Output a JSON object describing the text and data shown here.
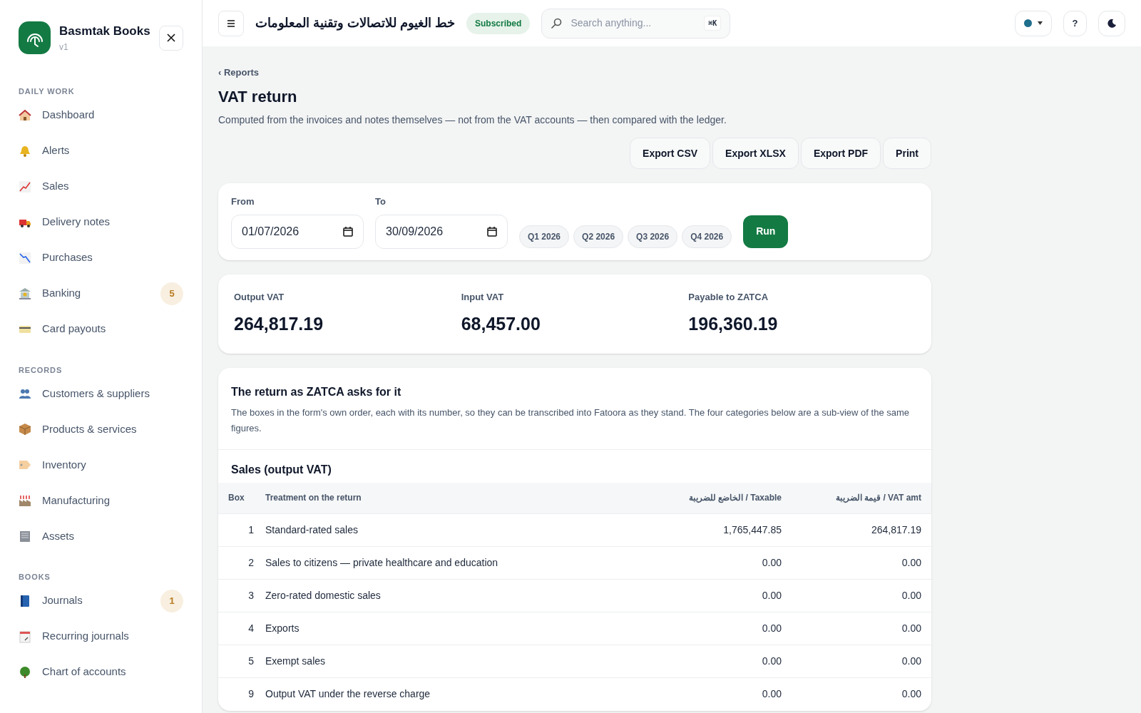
{
  "brand": {
    "name": "Basmtak Books",
    "version": "v1"
  },
  "sidebar": {
    "sections": [
      {
        "title": "DAILY WORK",
        "items": [
          {
            "label": "Dashboard"
          },
          {
            "label": "Alerts"
          },
          {
            "label": "Sales"
          },
          {
            "label": "Delivery notes"
          },
          {
            "label": "Purchases"
          },
          {
            "label": "Banking",
            "badge": "5"
          },
          {
            "label": "Card payouts"
          }
        ]
      },
      {
        "title": "RECORDS",
        "items": [
          {
            "label": "Customers & suppliers"
          },
          {
            "label": "Products & services"
          },
          {
            "label": "Inventory"
          },
          {
            "label": "Manufacturing"
          },
          {
            "label": "Assets"
          }
        ]
      },
      {
        "title": "BOOKS",
        "items": [
          {
            "label": "Journals",
            "badge": "1"
          },
          {
            "label": "Recurring journals"
          },
          {
            "label": "Chart of accounts"
          }
        ]
      }
    ]
  },
  "header": {
    "company": "خط الغيوم للاتصالات وتقنية المعلومات",
    "status": "Subscribed",
    "search": {
      "placeholder": "Search anything...",
      "shortcut": "⌘K"
    },
    "help": "?"
  },
  "breadcrumb": "‹ Reports",
  "title": "VAT return",
  "subtitle": "Computed from the invoices and notes themselves — not from the VAT accounts — then compared with the ledger.",
  "actions": [
    "Export CSV",
    "Export XLSX",
    "Export PDF",
    "Print"
  ],
  "filters": {
    "from": {
      "label": "From",
      "value": "01/07/2026"
    },
    "to": {
      "label": "To",
      "value": "30/09/2026"
    },
    "quarters": [
      "Q1 2026",
      "Q2 2026",
      "Q3 2026",
      "Q4 2026"
    ],
    "run": "Run"
  },
  "summary": [
    {
      "label": "Output VAT",
      "value": "264,817.19"
    },
    {
      "label": "Input VAT",
      "value": "68,457.00"
    },
    {
      "label": "Payable to ZATCA",
      "value": "196,360.19"
    }
  ],
  "return": {
    "title": "The return as ZATCA asks for it",
    "description": "The boxes in the form's own order, each with its number, so they can be transcribed into Fatoora as they stand. The four categories below are a sub-view of the same figures.",
    "section_title": "Sales (output VAT)",
    "columns": [
      "Box",
      "Treatment on the return",
      "الخاضع للضريبة / Taxable",
      "قيمة الضريبة / VAT amt"
    ],
    "rows": [
      [
        "1",
        "Standard-rated sales",
        "1,765,447.85",
        "264,817.19"
      ],
      [
        "2",
        "Sales to citizens — private healthcare and education",
        "0.00",
        "0.00"
      ],
      [
        "3",
        "Zero-rated domestic sales",
        "0.00",
        "0.00"
      ],
      [
        "4",
        "Exports",
        "0.00",
        "0.00"
      ],
      [
        "5",
        "Exempt sales",
        "0.00",
        "0.00"
      ],
      [
        "9",
        "Output VAT under the reverse charge",
        "0.00",
        "0.00"
      ]
    ]
  }
}
